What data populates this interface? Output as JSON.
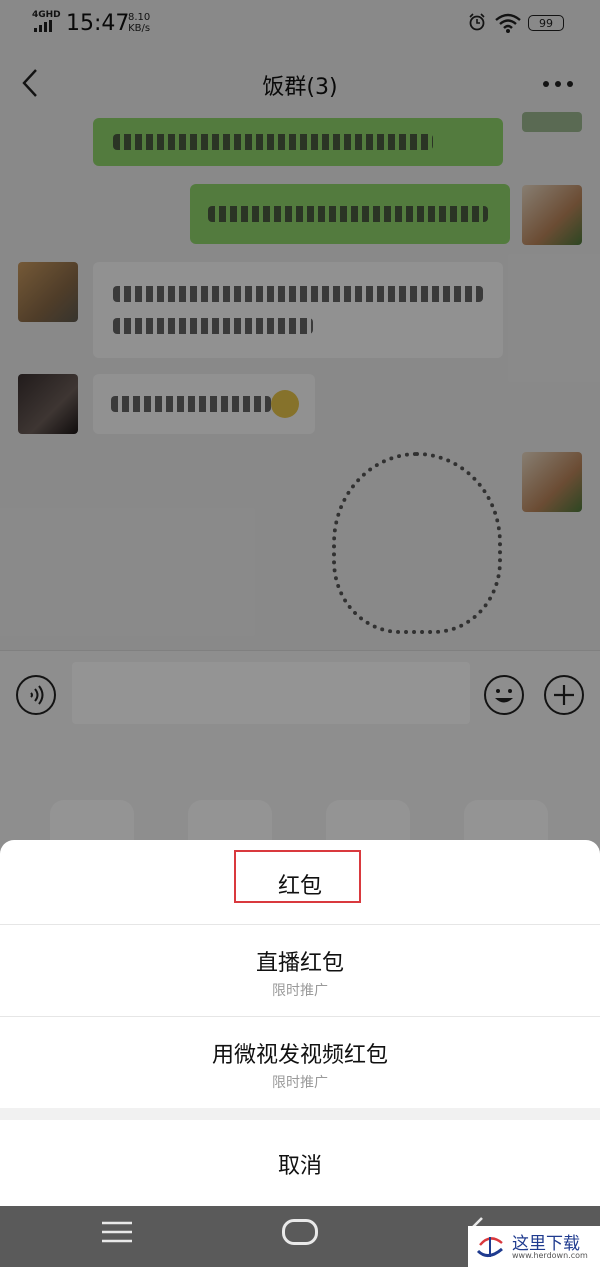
{
  "status_bar": {
    "network": "4GHD",
    "time": "15:47",
    "speed_value": "8.10",
    "speed_unit": "KB/s",
    "battery": "99"
  },
  "header": {
    "title": "饭群(3)"
  },
  "action_sheet": {
    "options": [
      {
        "label": "红包",
        "sub": ""
      },
      {
        "label": "直播红包",
        "sub": "限时推广"
      },
      {
        "label": "用微视发视频红包",
        "sub": "限时推广"
      }
    ],
    "cancel": "取消"
  },
  "watermark": {
    "text": "这里下载",
    "url": "www.herdown.com"
  },
  "colors": {
    "accent_green": "#8fd46b",
    "highlight_red": "#d9393e"
  }
}
